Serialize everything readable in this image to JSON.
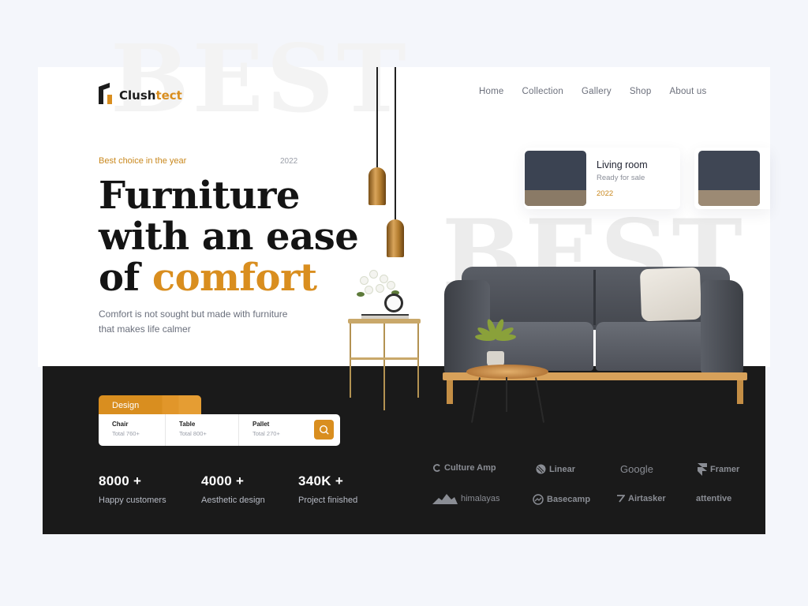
{
  "brand": {
    "name_main": "Clush",
    "name_accent": "tect"
  },
  "nav": [
    "Home",
    "Collection",
    "Gallery",
    "Shop",
    "About us"
  ],
  "hero": {
    "tagline": "Best choice in the year",
    "year": "2022",
    "title_line1": "Furniture",
    "title_line2": "with an ease",
    "title_line3_main": "of ",
    "title_line3_accent": "comfort",
    "subtitle": "Comfort is not sought but made with furniture that makes life calmer",
    "background_word": "BEST"
  },
  "room_card": {
    "title": "Living room",
    "subtitle": "Ready for sale",
    "year": "2022"
  },
  "search": {
    "tab_label": "Design",
    "items": [
      {
        "title": "Chair",
        "sub": "Total 760+"
      },
      {
        "title": "Table",
        "sub": "Total 800+"
      },
      {
        "title": "Pallet",
        "sub": "Total 270+"
      }
    ]
  },
  "stats": [
    {
      "value": "8000 +",
      "label": "Happy customers"
    },
    {
      "value": "4000 +",
      "label": "Aesthetic design"
    },
    {
      "value": "340K +",
      "label": "Project finished"
    }
  ],
  "partners": [
    "Culture Amp",
    "Linear",
    "Google",
    "Framer",
    "himalayas",
    "Basecamp",
    "Airtasker",
    "attentive"
  ],
  "colors": {
    "accent": "#d98e1f",
    "dark": "#1a1a1a",
    "background": "#f4f6fb"
  }
}
